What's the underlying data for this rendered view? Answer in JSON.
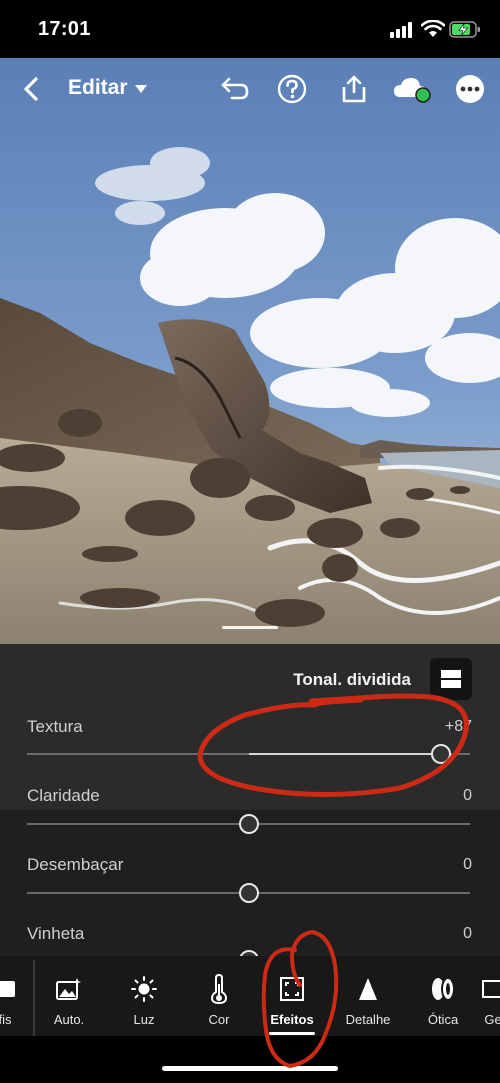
{
  "status_bar": {
    "time": "17:01"
  },
  "header": {
    "title": "Editar",
    "icons": [
      "back-icon",
      "chevron-down-icon",
      "undo-icon",
      "help-icon",
      "share-icon",
      "cloud-sync-icon",
      "more-icon"
    ],
    "sync_status_color": "#2fbf4f"
  },
  "panel": {
    "section_title": "Tonal. dividida",
    "sliders": [
      {
        "label": "Textura",
        "value": "+87",
        "position": 0.935
      },
      {
        "label": "Claridade",
        "value": "0",
        "position": 0.5
      },
      {
        "label": "Desembaçar",
        "value": "0",
        "position": 0.5
      },
      {
        "label": "Vinheta",
        "value": "0",
        "position": 0.5
      }
    ]
  },
  "toolbar": {
    "items": [
      {
        "label": "fis",
        "icon": "presets-icon"
      },
      {
        "label": "Auto.",
        "icon": "auto-icon"
      },
      {
        "label": "Luz",
        "icon": "sun-icon"
      },
      {
        "label": "Cor",
        "icon": "thermometer-icon"
      },
      {
        "label": "Efeitos",
        "icon": "effects-icon",
        "active": true
      },
      {
        "label": "Detalhe",
        "icon": "detail-icon"
      },
      {
        "label": "Ótica",
        "icon": "optics-icon"
      },
      {
        "label": "Ge",
        "icon": "geometry-icon"
      }
    ]
  },
  "colors": {
    "annotation": "#cc2a14",
    "panel": "#1f1f1f"
  }
}
